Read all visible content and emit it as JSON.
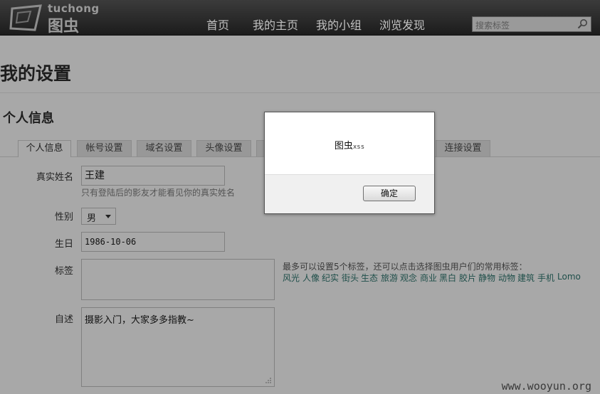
{
  "header": {
    "logo_latin": "tuchong",
    "logo_cn": "图虫",
    "nav": [
      "首页",
      "我的主页",
      "我的小组",
      "浏览发现"
    ],
    "search_placeholder": "搜索标签"
  },
  "page": {
    "title": "我的设置",
    "section": "个人信息"
  },
  "tabs": [
    "个人信息",
    "帐号设置",
    "域名设置",
    "头像设置",
    "",
    "",
    "",
    "连接设置"
  ],
  "form": {
    "name_label": "真实姓名",
    "name_value": "王建",
    "name_hint": "只有登陆后的影友才能看见你的真实姓名",
    "gender_label": "性别",
    "gender_value": "男",
    "birthday_label": "生日",
    "birthday_value": "1986-10-06",
    "tags_label": "标签",
    "tags_value": "",
    "tags_hint": "最多可以设置5个标签，还可以点击选择图虫用户们的常用标签：",
    "popular_tags": [
      "风光",
      "人像",
      "纪实",
      "街头",
      "生态",
      "旅游",
      "观念",
      "商业",
      "黑白",
      "胶片",
      "静物",
      "动物",
      "建筑",
      "手机",
      "Lomo"
    ],
    "bio_label": "自述",
    "bio_value": "摄影入门，大家多多指教~"
  },
  "dialog": {
    "message_main": "图虫",
    "message_small": "xss",
    "ok_label": "确定"
  },
  "watermark": "www.wooyun.org",
  "icons": {
    "search": "magnifier-icon",
    "logo": "tuchong-frame-logo",
    "select": "caret-down-icon",
    "resize": "resize-grip-icon"
  },
  "colors": {
    "overlay_bg": "#a8a8a8",
    "topbar": "#2a2a2a",
    "tag_link": "#1f4f4a"
  }
}
